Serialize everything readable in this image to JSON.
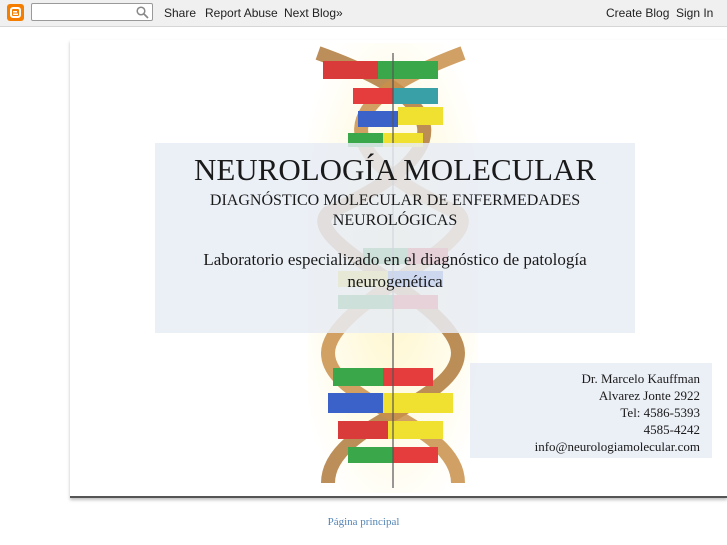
{
  "navbar": {
    "logo_icon": "blogger-logo-icon",
    "search_placeholder": "",
    "share": "Share",
    "report_abuse": "Report Abuse",
    "next_blog": "Next Blog»",
    "create_blog": "Create Blog",
    "sign_in": "Sign In"
  },
  "header": {
    "title": "NEUROLOGÍA MOLECULAR",
    "subtitle": "DIAGNÓSTICO MOLECULAR DE ENFERMEDADES NEUROLÓGICAS",
    "description": "Laboratorio especializado en el diagnóstico de patología neurogenética",
    "contact": {
      "name": "Dr. Marcelo Kauffman",
      "address": "Alvarez Jonte 2922",
      "phone1": "Tel: 4586-5393",
      "phone2": "4585-4242",
      "email": "info@neurologiamolecular.com"
    }
  },
  "footer": {
    "home_link": "Página principal"
  },
  "colors": {
    "navbar_bg": "#f0f0f0",
    "blogger_orange": "#f57d00",
    "panel_bg": "#e8ecf4",
    "link": "#5585b5"
  }
}
